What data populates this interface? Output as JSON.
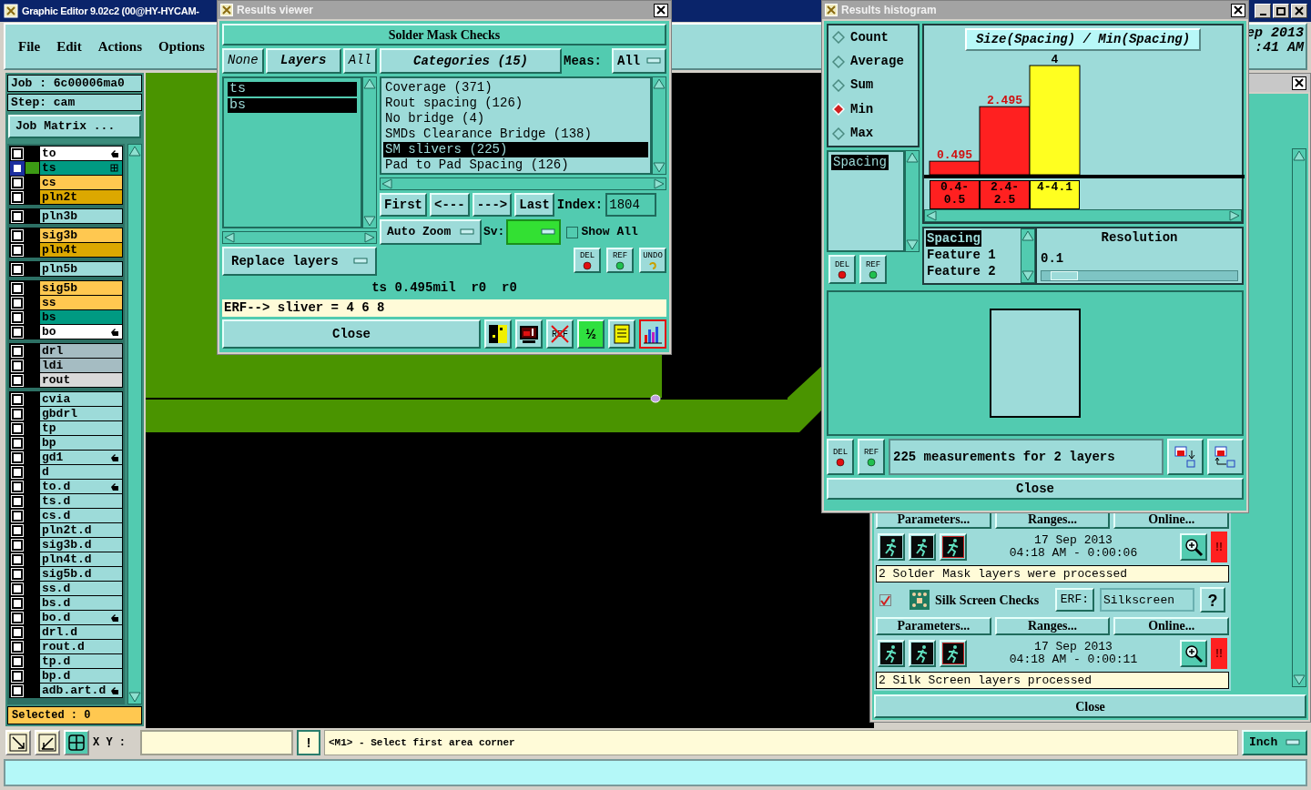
{
  "main_window": {
    "title": "Graphic Editor 9.02c2 (00@HY-HYCAM-",
    "menu": [
      "File",
      "Edit",
      "Actions",
      "Options"
    ],
    "clock": [
      "ep 2013",
      ":41 AM"
    ]
  },
  "job_panel": {
    "job": "Job : 6c00006ma0",
    "step": "Step: cam",
    "matrix_button": "Job Matrix ...",
    "selected": "Selected : 0"
  },
  "layer_groups": [
    {
      "layers": [
        {
          "name": "to",
          "color": "#ffffff",
          "kind": "pointer",
          "checked": false,
          "active": false
        },
        {
          "name": "ts",
          "color": "#009a82",
          "kind": "grid",
          "checked": false,
          "active": true
        },
        {
          "name": "cs",
          "color": "#ffc850",
          "kind": "plain",
          "checked": false,
          "active": false
        },
        {
          "name": "pln2t",
          "color": "#dca800",
          "kind": "plain",
          "checked": false,
          "active": false
        }
      ]
    },
    {
      "layers": [
        {
          "name": "pln3b",
          "color": "#9ddbd9",
          "kind": "plain",
          "checked": false,
          "active": false
        }
      ]
    },
    {
      "layers": [
        {
          "name": "sig3b",
          "color": "#ffc850",
          "kind": "plain",
          "checked": false,
          "active": false
        },
        {
          "name": "pln4t",
          "color": "#dca800",
          "kind": "plain",
          "checked": false,
          "active": false
        }
      ]
    },
    {
      "layers": [
        {
          "name": "pln5b",
          "color": "#9ddbd9",
          "kind": "plain",
          "checked": false,
          "active": false
        }
      ]
    },
    {
      "layers": [
        {
          "name": "sig5b",
          "color": "#ffc850",
          "kind": "plain",
          "checked": false,
          "active": false
        },
        {
          "name": "ss",
          "color": "#ffc850",
          "kind": "plain",
          "checked": false,
          "active": false
        },
        {
          "name": "bs",
          "color": "#009a82",
          "kind": "plain",
          "checked": false,
          "active": false
        },
        {
          "name": "bo",
          "color": "#ffffff",
          "kind": "pointer",
          "checked": false,
          "active": false
        }
      ]
    },
    {
      "layers": [
        {
          "name": "drl",
          "color": "#a5bcc2",
          "kind": "plain",
          "checked": false,
          "active": false
        },
        {
          "name": "ldi",
          "color": "#a5bcc2",
          "kind": "plain",
          "checked": false,
          "active": false
        },
        {
          "name": "rout",
          "color": "#d9d9d9",
          "kind": "plain",
          "checked": false,
          "active": false
        }
      ]
    },
    {
      "layers": [
        {
          "name": "cvia",
          "color": "#9ddbd9",
          "kind": "plain",
          "checked": false,
          "active": false
        },
        {
          "name": "gbdrl",
          "color": "#9ddbd9",
          "kind": "plain",
          "checked": false,
          "active": false
        },
        {
          "name": "tp",
          "color": "#9ddbd9",
          "kind": "plain",
          "checked": false,
          "active": false
        },
        {
          "name": "bp",
          "color": "#9ddbd9",
          "kind": "plain",
          "checked": false,
          "active": false
        },
        {
          "name": "gd1",
          "color": "#9ddbd9",
          "kind": "pointer",
          "checked": false,
          "active": false
        },
        {
          "name": "d",
          "color": "#9ddbd9",
          "kind": "plain",
          "checked": false,
          "active": false
        },
        {
          "name": "to.d",
          "color": "#9ddbd9",
          "kind": "pointer",
          "checked": false,
          "active": false
        },
        {
          "name": "ts.d",
          "color": "#9ddbd9",
          "kind": "plain",
          "checked": false,
          "active": false
        },
        {
          "name": "cs.d",
          "color": "#9ddbd9",
          "kind": "plain",
          "checked": false,
          "active": false
        },
        {
          "name": "pln2t.d",
          "color": "#9ddbd9",
          "kind": "plain",
          "checked": false,
          "active": false
        },
        {
          "name": "sig3b.d",
          "color": "#9ddbd9",
          "kind": "plain",
          "checked": false,
          "active": false
        },
        {
          "name": "pln4t.d",
          "color": "#9ddbd9",
          "kind": "plain",
          "checked": false,
          "active": false
        },
        {
          "name": "sig5b.d",
          "color": "#9ddbd9",
          "kind": "plain",
          "checked": false,
          "active": false
        },
        {
          "name": "ss.d",
          "color": "#9ddbd9",
          "kind": "plain",
          "checked": false,
          "active": false
        },
        {
          "name": "bs.d",
          "color": "#9ddbd9",
          "kind": "plain",
          "checked": false,
          "active": false
        },
        {
          "name": "bo.d",
          "color": "#9ddbd9",
          "kind": "pointer",
          "checked": false,
          "active": false
        },
        {
          "name": "drl.d",
          "color": "#9ddbd9",
          "kind": "plain",
          "checked": false,
          "active": false
        },
        {
          "name": "rout.d",
          "color": "#9ddbd9",
          "kind": "plain",
          "checked": false,
          "active": false
        },
        {
          "name": "tp.d",
          "color": "#9ddbd9",
          "kind": "plain",
          "checked": false,
          "active": false
        },
        {
          "name": "bp.d",
          "color": "#9ddbd9",
          "kind": "plain",
          "checked": false,
          "active": false
        },
        {
          "name": "adb.art.d",
          "color": "#9ddbd9",
          "kind": "pointer",
          "checked": false,
          "active": false
        }
      ]
    }
  ],
  "command_bar": {
    "coords_label": "X Y :",
    "alert_button": "!",
    "prompt": "<M1> - Select first area corner",
    "units": "Inch"
  },
  "checks_window": {
    "sections": [
      {
        "buttons": [
          "Parameters...",
          "Ranges...",
          "Online..."
        ],
        "date": "17 Sep 2013",
        "time": "04:18 AM - 0:00:06",
        "alert": "!!",
        "message": "2 Solder Mask layers were processed"
      },
      {
        "name": "Silk Screen Checks",
        "enabled": true,
        "erf_label": "ERF:",
        "erf_value": "Silkscreen",
        "help": "?",
        "buttons": [
          "Parameters...",
          "Ranges...",
          "Online..."
        ],
        "date": "17 Sep 2013",
        "time": "04:18 AM - 0:00:11",
        "alert": "!!",
        "message": "2 Silk Screen layers processed"
      }
    ],
    "close": "Close"
  },
  "results_viewer": {
    "title": "Results viewer",
    "header": "Solder Mask Checks",
    "layer_buttons": [
      "None",
      "Layers",
      "All"
    ],
    "layers": [
      {
        "name": "ts",
        "selected": true
      },
      {
        "name": "bs",
        "selected": true
      }
    ],
    "layer_mode": "Replace layers",
    "categories_button": "Categories (15)",
    "meas_label": "Meas:",
    "meas_value": "All",
    "categories": [
      {
        "label": "Coverage (371)",
        "selected": false
      },
      {
        "label": "Rout spacing (126)",
        "selected": false
      },
      {
        "label": "No bridge (4)",
        "selected": false
      },
      {
        "label": "SMDs Clearance Bridge (138)",
        "selected": false
      },
      {
        "label": "SM slivers (225)",
        "selected": true
      },
      {
        "label": "Pad to Pad Spacing (126)",
        "selected": false
      }
    ],
    "nav_buttons": [
      "First",
      "<---",
      "--->",
      "Last"
    ],
    "index_label": "Index:",
    "index_value": "1804",
    "zoom_mode": "Auto Zoom",
    "sv_label": "Sv:",
    "show_all": {
      "label": "Show All",
      "checked": false
    },
    "edit_buttons": [
      {
        "kind": "del",
        "label": "DEL"
      },
      {
        "kind": "ref",
        "label": "REF"
      },
      {
        "kind": "undo",
        "label": "UNDO"
      }
    ],
    "measurement": "ts 0.495mil  r0  r0",
    "erf": "ERF--> sliver = 4 6 8",
    "close": "Close",
    "tools": [
      {
        "kind": "split",
        "selected": false
      },
      {
        "kind": "monitor",
        "selected": false
      },
      {
        "kind": "ref-off",
        "label": "REF",
        "selected": false
      },
      {
        "kind": "page",
        "label": "½",
        "selected": false
      },
      {
        "kind": "notes",
        "selected": false
      },
      {
        "kind": "histogram",
        "selected": true
      }
    ]
  },
  "results_histogram": {
    "title": "Results histogram",
    "functions": [
      {
        "label": "Count",
        "selected": false
      },
      {
        "label": "Average",
        "selected": false
      },
      {
        "label": "Sum",
        "selected": false
      },
      {
        "label": "Min",
        "selected": true
      },
      {
        "label": "Max",
        "selected": false
      }
    ],
    "attributes": [
      {
        "label": "Spacing",
        "selected": true
      }
    ],
    "side_buttons": [
      {
        "kind": "del",
        "label": "DEL"
      },
      {
        "kind": "ref",
        "label": "REF"
      }
    ],
    "chart_data": {
      "type": "bar",
      "title": "Size(Spacing) / Min(Spacing)",
      "categories": [
        "0.4-0.5",
        "2.4-2.5",
        "4-4.1"
      ],
      "series": [
        {
          "color": "#ff2020",
          "colors": [
            "#ff2020",
            "#ff2020",
            "#ffff20"
          ],
          "values": [
            0.495,
            2.495,
            4
          ]
        }
      ],
      "data_labels": true
    },
    "fields": [
      {
        "label": "Spacing",
        "selected": true
      },
      {
        "label": "Feature 1",
        "selected": false
      },
      {
        "label": "Feature 2",
        "selected": false
      }
    ],
    "resolution": {
      "label": "Resolution",
      "value": "0.1",
      "level": 0.05
    },
    "bottom_buttons": [
      {
        "kind": "del",
        "label": "DEL"
      },
      {
        "kind": "ref",
        "label": "REF"
      }
    ],
    "summary": "225 measurements for 2 layers",
    "export_buttons": [
      {
        "kind": "export"
      },
      {
        "kind": "import"
      }
    ],
    "close": "Close"
  }
}
